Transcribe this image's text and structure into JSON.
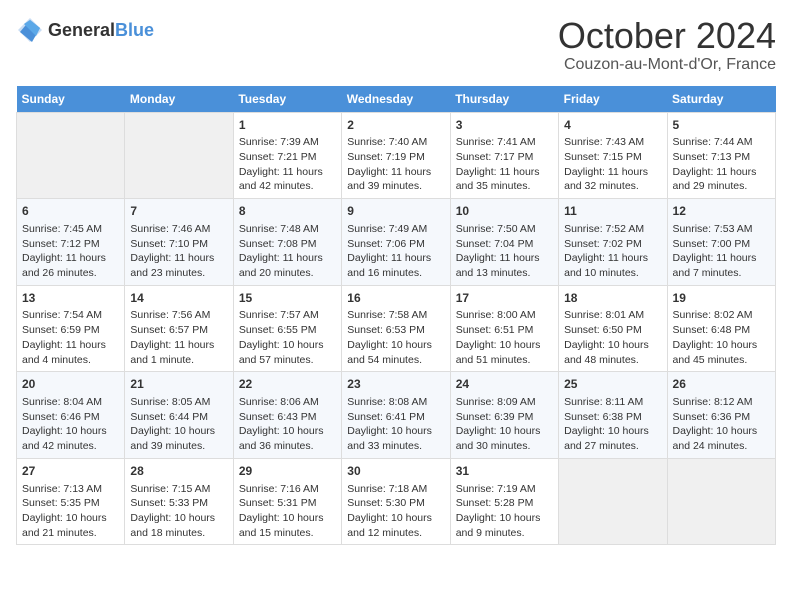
{
  "header": {
    "logo_general": "General",
    "logo_blue": "Blue",
    "month": "October 2024",
    "location": "Couzon-au-Mont-d'Or, France"
  },
  "days_of_week": [
    "Sunday",
    "Monday",
    "Tuesday",
    "Wednesday",
    "Thursday",
    "Friday",
    "Saturday"
  ],
  "weeks": [
    [
      {
        "day": "",
        "empty": true
      },
      {
        "day": "",
        "empty": true
      },
      {
        "day": "1",
        "sunrise": "Sunrise: 7:39 AM",
        "sunset": "Sunset: 7:21 PM",
        "daylight": "Daylight: 11 hours and 42 minutes."
      },
      {
        "day": "2",
        "sunrise": "Sunrise: 7:40 AM",
        "sunset": "Sunset: 7:19 PM",
        "daylight": "Daylight: 11 hours and 39 minutes."
      },
      {
        "day": "3",
        "sunrise": "Sunrise: 7:41 AM",
        "sunset": "Sunset: 7:17 PM",
        "daylight": "Daylight: 11 hours and 35 minutes."
      },
      {
        "day": "4",
        "sunrise": "Sunrise: 7:43 AM",
        "sunset": "Sunset: 7:15 PM",
        "daylight": "Daylight: 11 hours and 32 minutes."
      },
      {
        "day": "5",
        "sunrise": "Sunrise: 7:44 AM",
        "sunset": "Sunset: 7:13 PM",
        "daylight": "Daylight: 11 hours and 29 minutes."
      }
    ],
    [
      {
        "day": "6",
        "sunrise": "Sunrise: 7:45 AM",
        "sunset": "Sunset: 7:12 PM",
        "daylight": "Daylight: 11 hours and 26 minutes."
      },
      {
        "day": "7",
        "sunrise": "Sunrise: 7:46 AM",
        "sunset": "Sunset: 7:10 PM",
        "daylight": "Daylight: 11 hours and 23 minutes."
      },
      {
        "day": "8",
        "sunrise": "Sunrise: 7:48 AM",
        "sunset": "Sunset: 7:08 PM",
        "daylight": "Daylight: 11 hours and 20 minutes."
      },
      {
        "day": "9",
        "sunrise": "Sunrise: 7:49 AM",
        "sunset": "Sunset: 7:06 PM",
        "daylight": "Daylight: 11 hours and 16 minutes."
      },
      {
        "day": "10",
        "sunrise": "Sunrise: 7:50 AM",
        "sunset": "Sunset: 7:04 PM",
        "daylight": "Daylight: 11 hours and 13 minutes."
      },
      {
        "day": "11",
        "sunrise": "Sunrise: 7:52 AM",
        "sunset": "Sunset: 7:02 PM",
        "daylight": "Daylight: 11 hours and 10 minutes."
      },
      {
        "day": "12",
        "sunrise": "Sunrise: 7:53 AM",
        "sunset": "Sunset: 7:00 PM",
        "daylight": "Daylight: 11 hours and 7 minutes."
      }
    ],
    [
      {
        "day": "13",
        "sunrise": "Sunrise: 7:54 AM",
        "sunset": "Sunset: 6:59 PM",
        "daylight": "Daylight: 11 hours and 4 minutes."
      },
      {
        "day": "14",
        "sunrise": "Sunrise: 7:56 AM",
        "sunset": "Sunset: 6:57 PM",
        "daylight": "Daylight: 11 hours and 1 minute."
      },
      {
        "day": "15",
        "sunrise": "Sunrise: 7:57 AM",
        "sunset": "Sunset: 6:55 PM",
        "daylight": "Daylight: 10 hours and 57 minutes."
      },
      {
        "day": "16",
        "sunrise": "Sunrise: 7:58 AM",
        "sunset": "Sunset: 6:53 PM",
        "daylight": "Daylight: 10 hours and 54 minutes."
      },
      {
        "day": "17",
        "sunrise": "Sunrise: 8:00 AM",
        "sunset": "Sunset: 6:51 PM",
        "daylight": "Daylight: 10 hours and 51 minutes."
      },
      {
        "day": "18",
        "sunrise": "Sunrise: 8:01 AM",
        "sunset": "Sunset: 6:50 PM",
        "daylight": "Daylight: 10 hours and 48 minutes."
      },
      {
        "day": "19",
        "sunrise": "Sunrise: 8:02 AM",
        "sunset": "Sunset: 6:48 PM",
        "daylight": "Daylight: 10 hours and 45 minutes."
      }
    ],
    [
      {
        "day": "20",
        "sunrise": "Sunrise: 8:04 AM",
        "sunset": "Sunset: 6:46 PM",
        "daylight": "Daylight: 10 hours and 42 minutes."
      },
      {
        "day": "21",
        "sunrise": "Sunrise: 8:05 AM",
        "sunset": "Sunset: 6:44 PM",
        "daylight": "Daylight: 10 hours and 39 minutes."
      },
      {
        "day": "22",
        "sunrise": "Sunrise: 8:06 AM",
        "sunset": "Sunset: 6:43 PM",
        "daylight": "Daylight: 10 hours and 36 minutes."
      },
      {
        "day": "23",
        "sunrise": "Sunrise: 8:08 AM",
        "sunset": "Sunset: 6:41 PM",
        "daylight": "Daylight: 10 hours and 33 minutes."
      },
      {
        "day": "24",
        "sunrise": "Sunrise: 8:09 AM",
        "sunset": "Sunset: 6:39 PM",
        "daylight": "Daylight: 10 hours and 30 minutes."
      },
      {
        "day": "25",
        "sunrise": "Sunrise: 8:11 AM",
        "sunset": "Sunset: 6:38 PM",
        "daylight": "Daylight: 10 hours and 27 minutes."
      },
      {
        "day": "26",
        "sunrise": "Sunrise: 8:12 AM",
        "sunset": "Sunset: 6:36 PM",
        "daylight": "Daylight: 10 hours and 24 minutes."
      }
    ],
    [
      {
        "day": "27",
        "sunrise": "Sunrise: 7:13 AM",
        "sunset": "Sunset: 5:35 PM",
        "daylight": "Daylight: 10 hours and 21 minutes."
      },
      {
        "day": "28",
        "sunrise": "Sunrise: 7:15 AM",
        "sunset": "Sunset: 5:33 PM",
        "daylight": "Daylight: 10 hours and 18 minutes."
      },
      {
        "day": "29",
        "sunrise": "Sunrise: 7:16 AM",
        "sunset": "Sunset: 5:31 PM",
        "daylight": "Daylight: 10 hours and 15 minutes."
      },
      {
        "day": "30",
        "sunrise": "Sunrise: 7:18 AM",
        "sunset": "Sunset: 5:30 PM",
        "daylight": "Daylight: 10 hours and 12 minutes."
      },
      {
        "day": "31",
        "sunrise": "Sunrise: 7:19 AM",
        "sunset": "Sunset: 5:28 PM",
        "daylight": "Daylight: 10 hours and 9 minutes."
      },
      {
        "day": "",
        "empty": true
      },
      {
        "day": "",
        "empty": true
      }
    ]
  ]
}
